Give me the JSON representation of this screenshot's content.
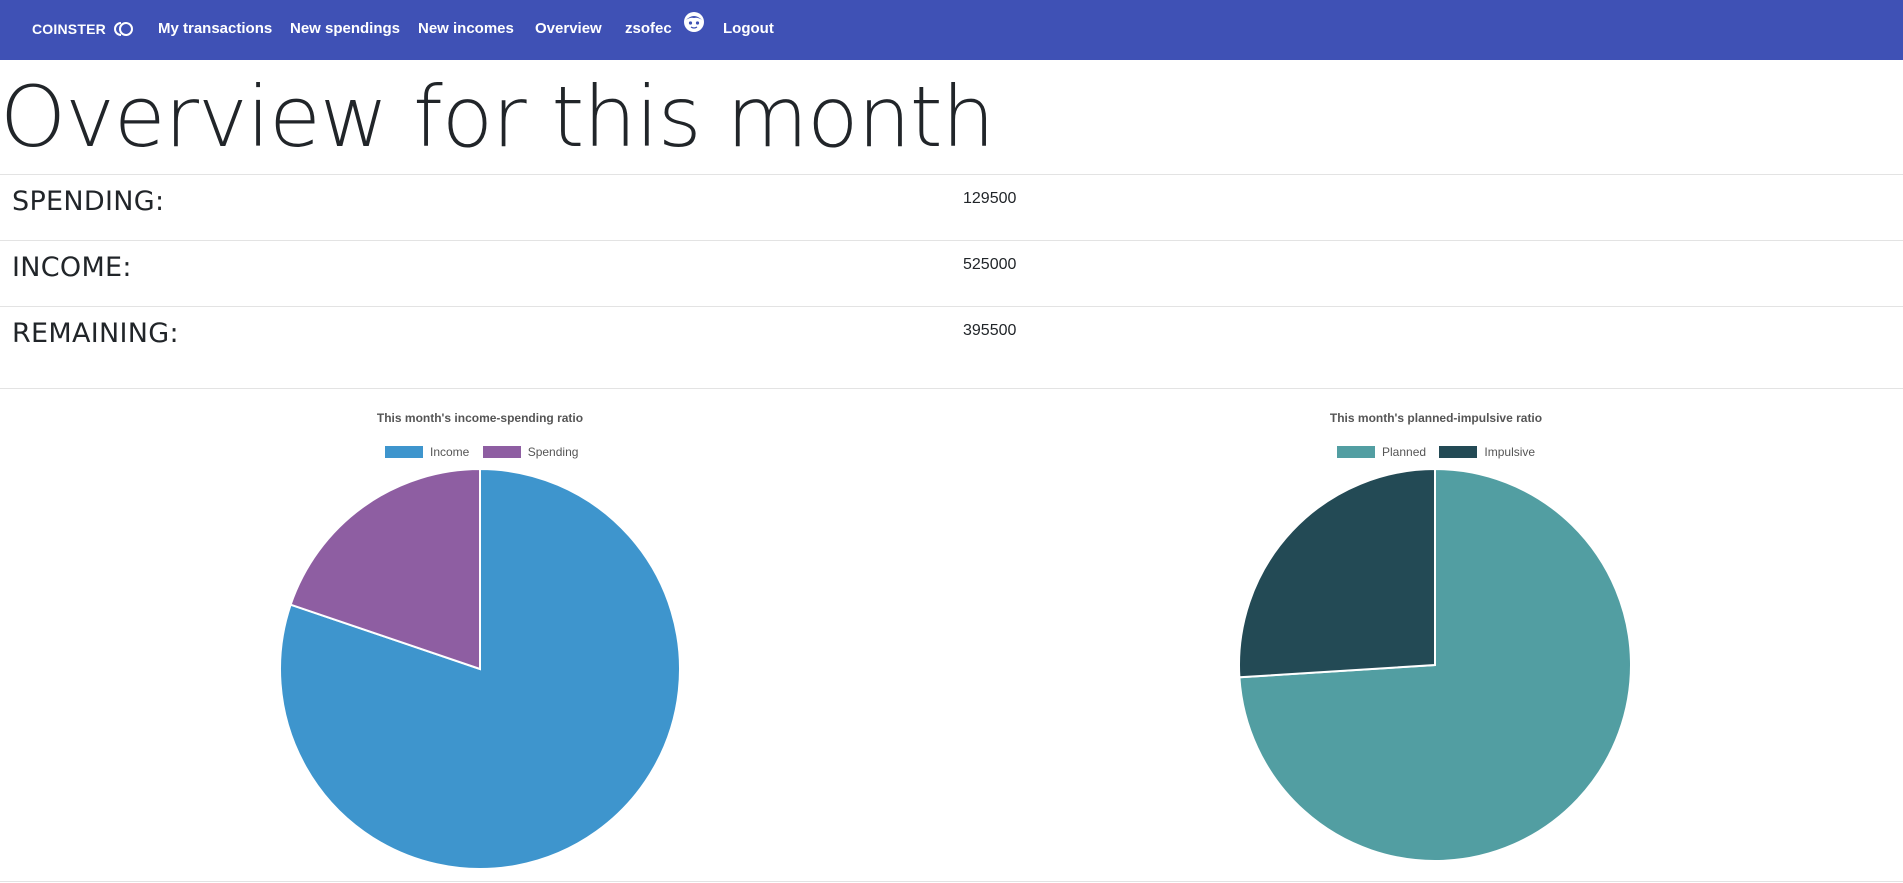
{
  "navbar": {
    "brand": "COINSTER",
    "items": [
      "My transactions",
      "New spendings",
      "New incomes",
      "Overview",
      "zsofec",
      "Logout"
    ],
    "color": "#3f51b5"
  },
  "page": {
    "title": "Overview for this month"
  },
  "summary": [
    {
      "label": "SPENDING:",
      "value": "129500"
    },
    {
      "label": "INCOME:",
      "value": "525000"
    },
    {
      "label": "REMAINING:",
      "value": "395500"
    }
  ],
  "chart_data": [
    {
      "type": "pie",
      "title": "This month's income-spending ratio",
      "categories": [
        "Income",
        "Spending"
      ],
      "values": [
        525000,
        129500
      ],
      "colors": [
        "#3e95cd",
        "#8e5ea2"
      ],
      "legend": "top"
    },
    {
      "type": "pie",
      "title": "This month's planned-impulsive ratio",
      "categories": [
        "Planned",
        "Impulsive"
      ],
      "values": [
        74,
        26
      ],
      "colors": [
        "#529ea2",
        "#234a55"
      ],
      "legend": "top"
    }
  ]
}
